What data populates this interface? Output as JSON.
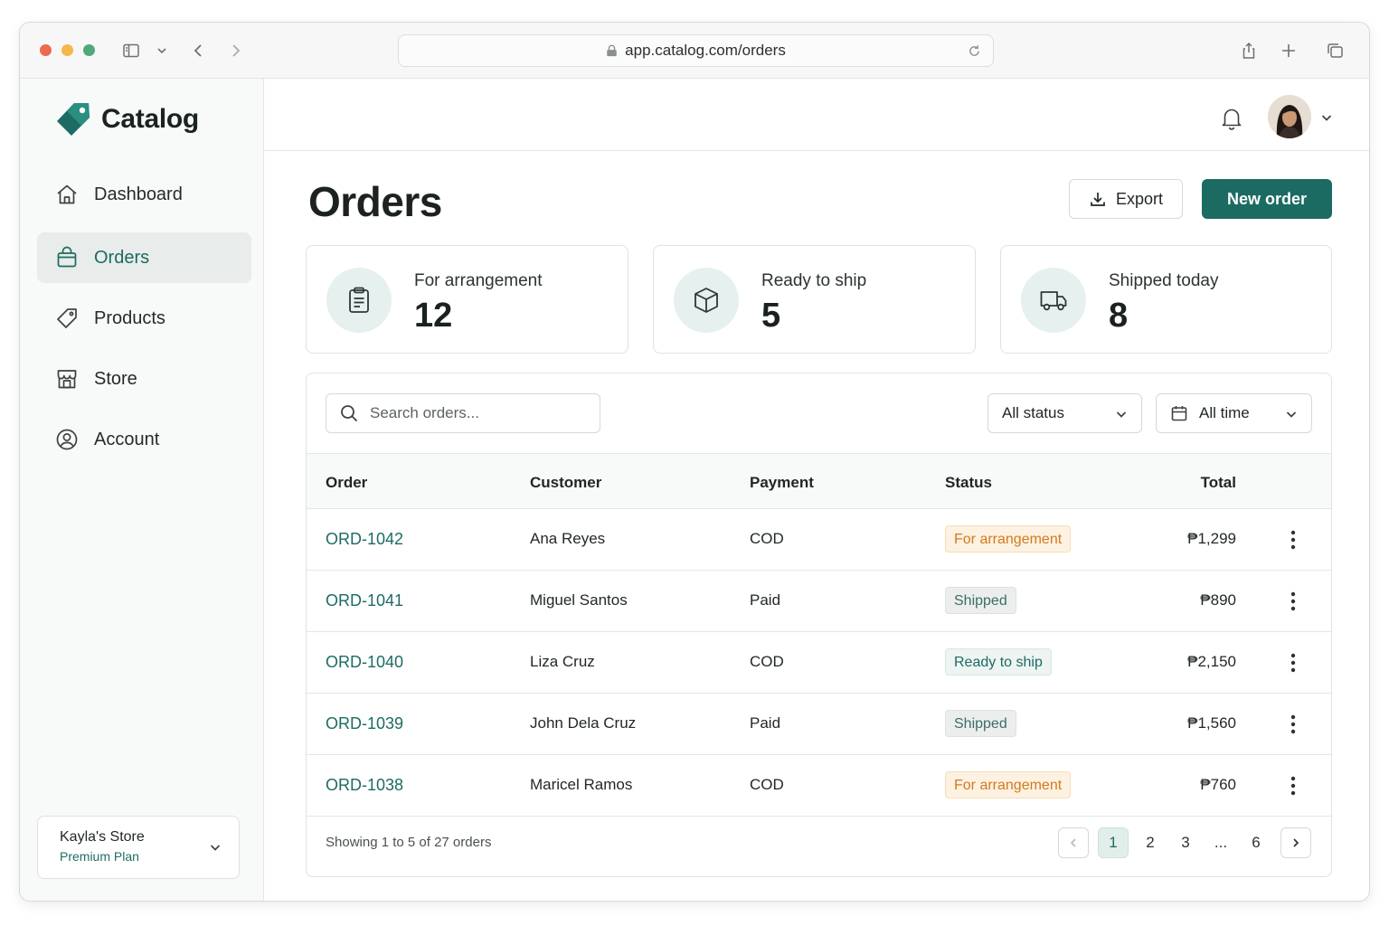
{
  "browser": {
    "url": "app.catalog.com/orders"
  },
  "brand": {
    "name": "Catalog",
    "accent": "#1c6b62"
  },
  "sidebar": {
    "items": [
      {
        "label": "Dashboard",
        "icon": "home-icon"
      },
      {
        "label": "Orders",
        "icon": "shopping-bag-icon",
        "active": true
      },
      {
        "label": "Products",
        "icon": "tag-icon"
      },
      {
        "label": "Store",
        "icon": "storefront-icon"
      },
      {
        "label": "Account",
        "icon": "user-circle-icon"
      }
    ],
    "store": {
      "name": "Kayla's Store",
      "plan": "Premium Plan"
    }
  },
  "header": {
    "title": "Orders",
    "export_label": "Export",
    "new_order_label": "New order"
  },
  "stats": [
    {
      "label": "For arrangement",
      "value": "12",
      "icon": "clipboard-icon"
    },
    {
      "label": "Ready to ship",
      "value": "5",
      "icon": "box-icon"
    },
    {
      "label": "Shipped today",
      "value": "8",
      "icon": "truck-icon"
    }
  ],
  "filters": {
    "search_placeholder": "Search orders...",
    "status_value": "All status",
    "time_value": "All time"
  },
  "table": {
    "columns": [
      "Order",
      "Customer",
      "Payment",
      "Status",
      "Total"
    ],
    "rows": [
      {
        "order": "ORD-1042",
        "customer": "Ana Reyes",
        "payment": "COD",
        "status": "For arrangement",
        "status_kind": "arr",
        "total": "₱1,299"
      },
      {
        "order": "ORD-1041",
        "customer": "Miguel Santos",
        "payment": "Paid",
        "status": "Shipped",
        "status_kind": "shipped",
        "total": "₱890"
      },
      {
        "order": "ORD-1040",
        "customer": "Liza Cruz",
        "payment": "COD",
        "status": "Ready to ship",
        "status_kind": "ready",
        "total": "₱2,150"
      },
      {
        "order": "ORD-1039",
        "customer": "John Dela Cruz",
        "payment": "Paid",
        "status": "Shipped",
        "status_kind": "shipped",
        "total": "₱1,560"
      },
      {
        "order": "ORD-1038",
        "customer": "Maricel Ramos",
        "payment": "COD",
        "status": "For arrangement",
        "status_kind": "arr",
        "total": "₱760"
      }
    ]
  },
  "pagination": {
    "summary": "Showing 1 to 5 of 27 orders",
    "pages": [
      "1",
      "2",
      "3",
      "...",
      "6"
    ],
    "current": "1"
  }
}
